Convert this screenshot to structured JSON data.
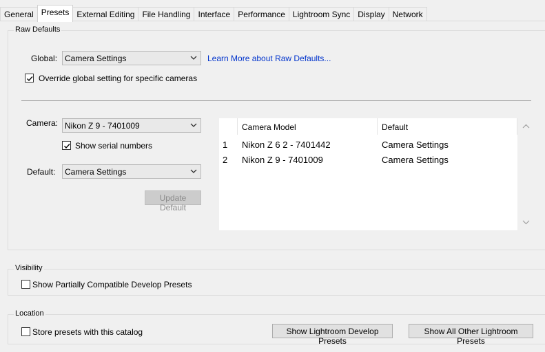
{
  "tabs": [
    "General",
    "Presets",
    "External Editing",
    "File Handling",
    "Interface",
    "Performance",
    "Lightroom Sync",
    "Display",
    "Network"
  ],
  "active_tab": "Presets",
  "raw_defaults": {
    "title": "Raw Defaults",
    "global_label": "Global:",
    "global_value": "Camera Settings",
    "learn_more_link": "Learn More about Raw Defaults...",
    "override_label": "Override global setting for specific cameras",
    "override_checked": true,
    "camera_label": "Camera:",
    "camera_value": "Nikon Z 9 - 7401009",
    "serial_label": "Show serial numbers",
    "serial_checked": true,
    "default_label": "Default:",
    "default_value": "Camera Settings",
    "update_button": "Update Default",
    "table": {
      "columns": [
        "Camera Model",
        "Default"
      ],
      "rows": [
        {
          "num": "1",
          "model": "Nikon Z 6 2 - 7401442",
          "default": "Camera Settings"
        },
        {
          "num": "2",
          "model": "Nikon Z 9 - 7401009",
          "default": "Camera Settings"
        }
      ]
    }
  },
  "visibility": {
    "title": "Visibility",
    "partial_label": "Show Partially Compatible Develop Presets",
    "partial_checked": false
  },
  "location": {
    "title": "Location",
    "store_label": "Store presets with this catalog",
    "store_checked": false,
    "develop_button": "Show Lightroom Develop Presets",
    "other_button": "Show All Other Lightroom Presets"
  },
  "colors": {
    "link": "#0033cc",
    "background": "#f0f0f0"
  },
  "icons": [
    "chevron-down-icon",
    "checkmark-icon",
    "scroll-up-arrow-icon",
    "scroll-down-arrow-icon"
  ]
}
